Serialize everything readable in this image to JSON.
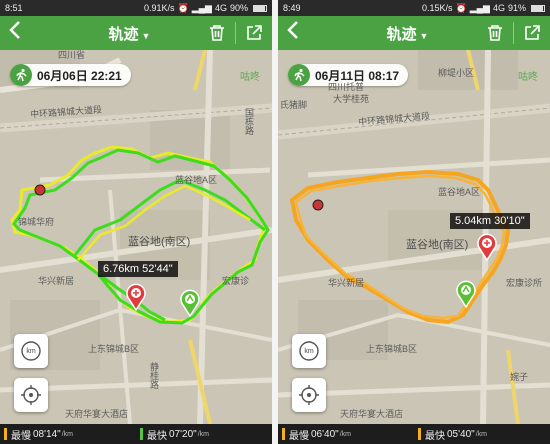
{
  "screens": [
    {
      "status": {
        "time": "8:51",
        "speed": "0.91K/s",
        "network": "4G",
        "battery": "90%",
        "battery_level": 0.9
      },
      "appbar": {
        "title": "轨迹"
      },
      "date_time": "06月06日 22:21",
      "tooltip": "6.76km  52'44\"",
      "map_labels": {
        "top": "四川省",
        "right_top": "咕咚",
        "area": "蓝谷地(南区)",
        "area_a": "蓝谷地A区",
        "road": "中环路锦城大道段",
        "left_mid": "蓝",
        "left_mid2": "锦城华府",
        "hua_xing": "华兴新居",
        "hong_kang": "宏康诊",
        "shang_dong": "上东锦城B区",
        "tian_fu": "天府华宴大酒店",
        "guo_lu": "国栋路",
        "jing_gui": "静桂路"
      },
      "footer": {
        "slowest_label": "最慢",
        "slowest_value": "08'14\"",
        "fastest_label": "最快",
        "fastest_value": "07'20\"",
        "unit": "/km",
        "slow_color": "#f2b01e",
        "fast_color": "#59c540"
      }
    },
    {
      "status": {
        "time": "8:49",
        "speed": "0.15K/s",
        "network": "4G",
        "battery": "91%",
        "battery_level": 0.91
      },
      "appbar": {
        "title": "轨迹"
      },
      "date_time": "06月11日 08:17",
      "tooltip": "5.04km  30'10\"",
      "map_labels": {
        "top": "柳堤小区",
        "right_top": "咕咚",
        "top2": "四川托普",
        "top3": "大学桂苑",
        "left": "氏猪脚",
        "area": "蓝谷地(南区)",
        "area_a": "蓝谷地A区",
        "road": "中环路锦城大道段",
        "hua_xing": "华兴新居",
        "hong_kang": "宏康诊所",
        "shang_dong": "上东锦城B区",
        "tian_fu": "天府华宴大酒店",
        "yuan_zi": "婉子"
      },
      "footer": {
        "slowest_label": "最慢",
        "slowest_value": "06'40\"",
        "fastest_label": "最快",
        "fastest_value": "05'40\"",
        "unit": "/km",
        "slow_color": "#f2b01e",
        "fast_color": "#f2b01e"
      }
    }
  ],
  "colors": {
    "app_green": "#4aa243",
    "track_green": "#3ddc1c",
    "track_yellow": "#e9ea2a",
    "track_orange": "#f5a51e"
  },
  "icons": {
    "back": "chevron-left-icon",
    "title_dropdown": "caret-down-icon",
    "delete": "trash-icon",
    "share": "share-icon",
    "runner": "runner-icon",
    "km": "km-toggle-icon",
    "locate": "locate-icon",
    "start": "start-marker-icon",
    "end": "end-marker-icon"
  }
}
